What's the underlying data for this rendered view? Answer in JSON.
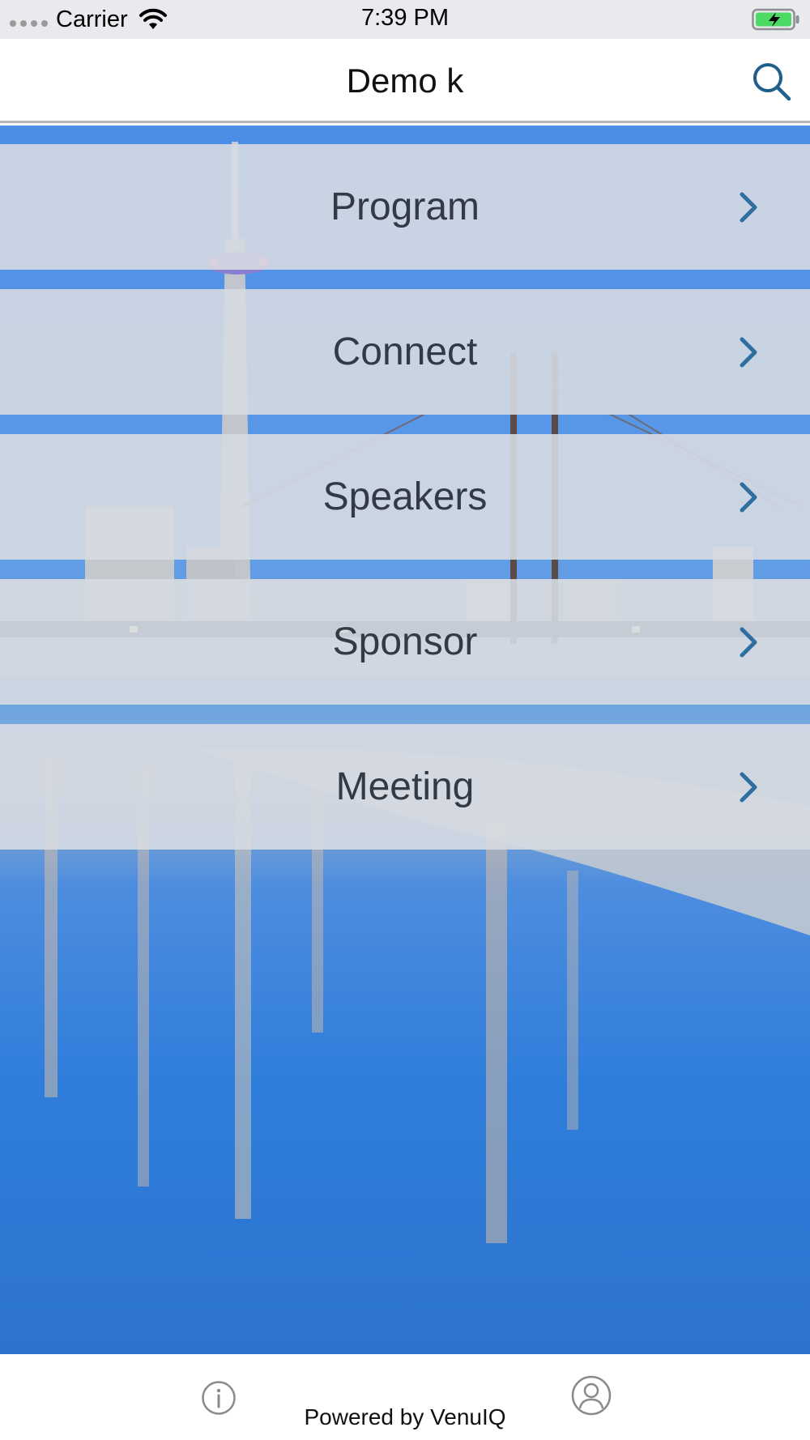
{
  "status_bar": {
    "carrier": "Carrier",
    "time": "7:39 PM",
    "icons": [
      "signal-dots-icon",
      "wifi-icon",
      "battery-charging-icon"
    ],
    "battery_color": "#4cd964"
  },
  "nav": {
    "title": "Demo k",
    "search_icon": "search-icon"
  },
  "menu": {
    "items": [
      {
        "label": "Program"
      },
      {
        "label": "Connect"
      },
      {
        "label": "Speakers"
      },
      {
        "label": "Sponsor"
      },
      {
        "label": "Meeting"
      }
    ],
    "chevron_icon": "chevron-right-icon",
    "accent_color": "#2f6f9f"
  },
  "footer": {
    "info_icon": "info-icon",
    "profile_icon": "profile-icon",
    "powered_by": "Powered by VenuIQ"
  }
}
